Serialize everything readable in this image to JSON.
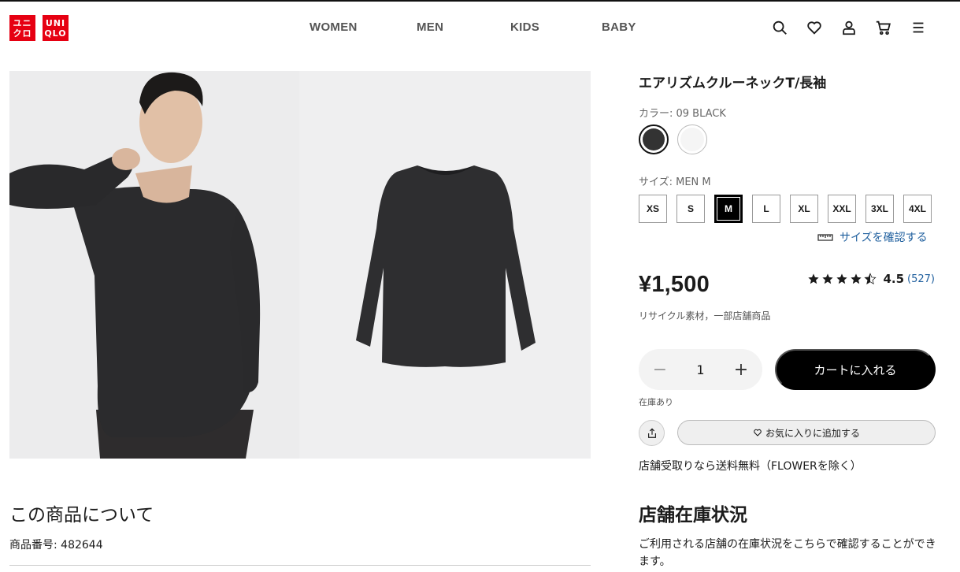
{
  "header": {
    "logo_jp": [
      "ユニ",
      "クロ"
    ],
    "logo_en": [
      "UNI",
      "QLO"
    ],
    "nav": [
      "WOMEN",
      "MEN",
      "KIDS",
      "BABY"
    ],
    "icons": [
      "search-icon",
      "heart-icon",
      "user-icon",
      "cart-icon",
      "menu-icon"
    ]
  },
  "product": {
    "name": "エアリズムクルーネックT/長袖",
    "color_label": "カラー: 09 BLACK",
    "colors": [
      {
        "name": "BLACK",
        "hex": "#333333",
        "selected": true
      },
      {
        "name": "WHITE",
        "hex": "#f5f5f5",
        "selected": false
      }
    ],
    "size_label": "サイズ: MEN M",
    "sizes": [
      "XS",
      "S",
      "M",
      "L",
      "XL",
      "XXL",
      "3XL",
      "4XL"
    ],
    "selected_size": "M",
    "size_check": "サイズを確認する",
    "price": "¥1,500",
    "rating_value": "4.5",
    "rating_count": "(527)",
    "rating_stars": 4.5,
    "feature": "リサイクル素材，一部店舗商品",
    "quantity": "1",
    "qty_minus": "−",
    "qty_plus": "+",
    "cart_button": "カートに入れる",
    "stock": "在庫あり",
    "favorite_button": "お気に入りに追加する",
    "pickup_note": "店舗受取りなら送料無料（FLOWERを除く）"
  },
  "about": {
    "title": "この商品について",
    "product_number": "商品番号: 482644"
  },
  "store": {
    "title": "店舗在庫状況",
    "text": "ご利用される店舗の在庫状況をこちらで確認することができます。"
  },
  "colors": {
    "brand_red": "#e60012",
    "link_blue": "#1f5f9e",
    "black": "#000000"
  }
}
